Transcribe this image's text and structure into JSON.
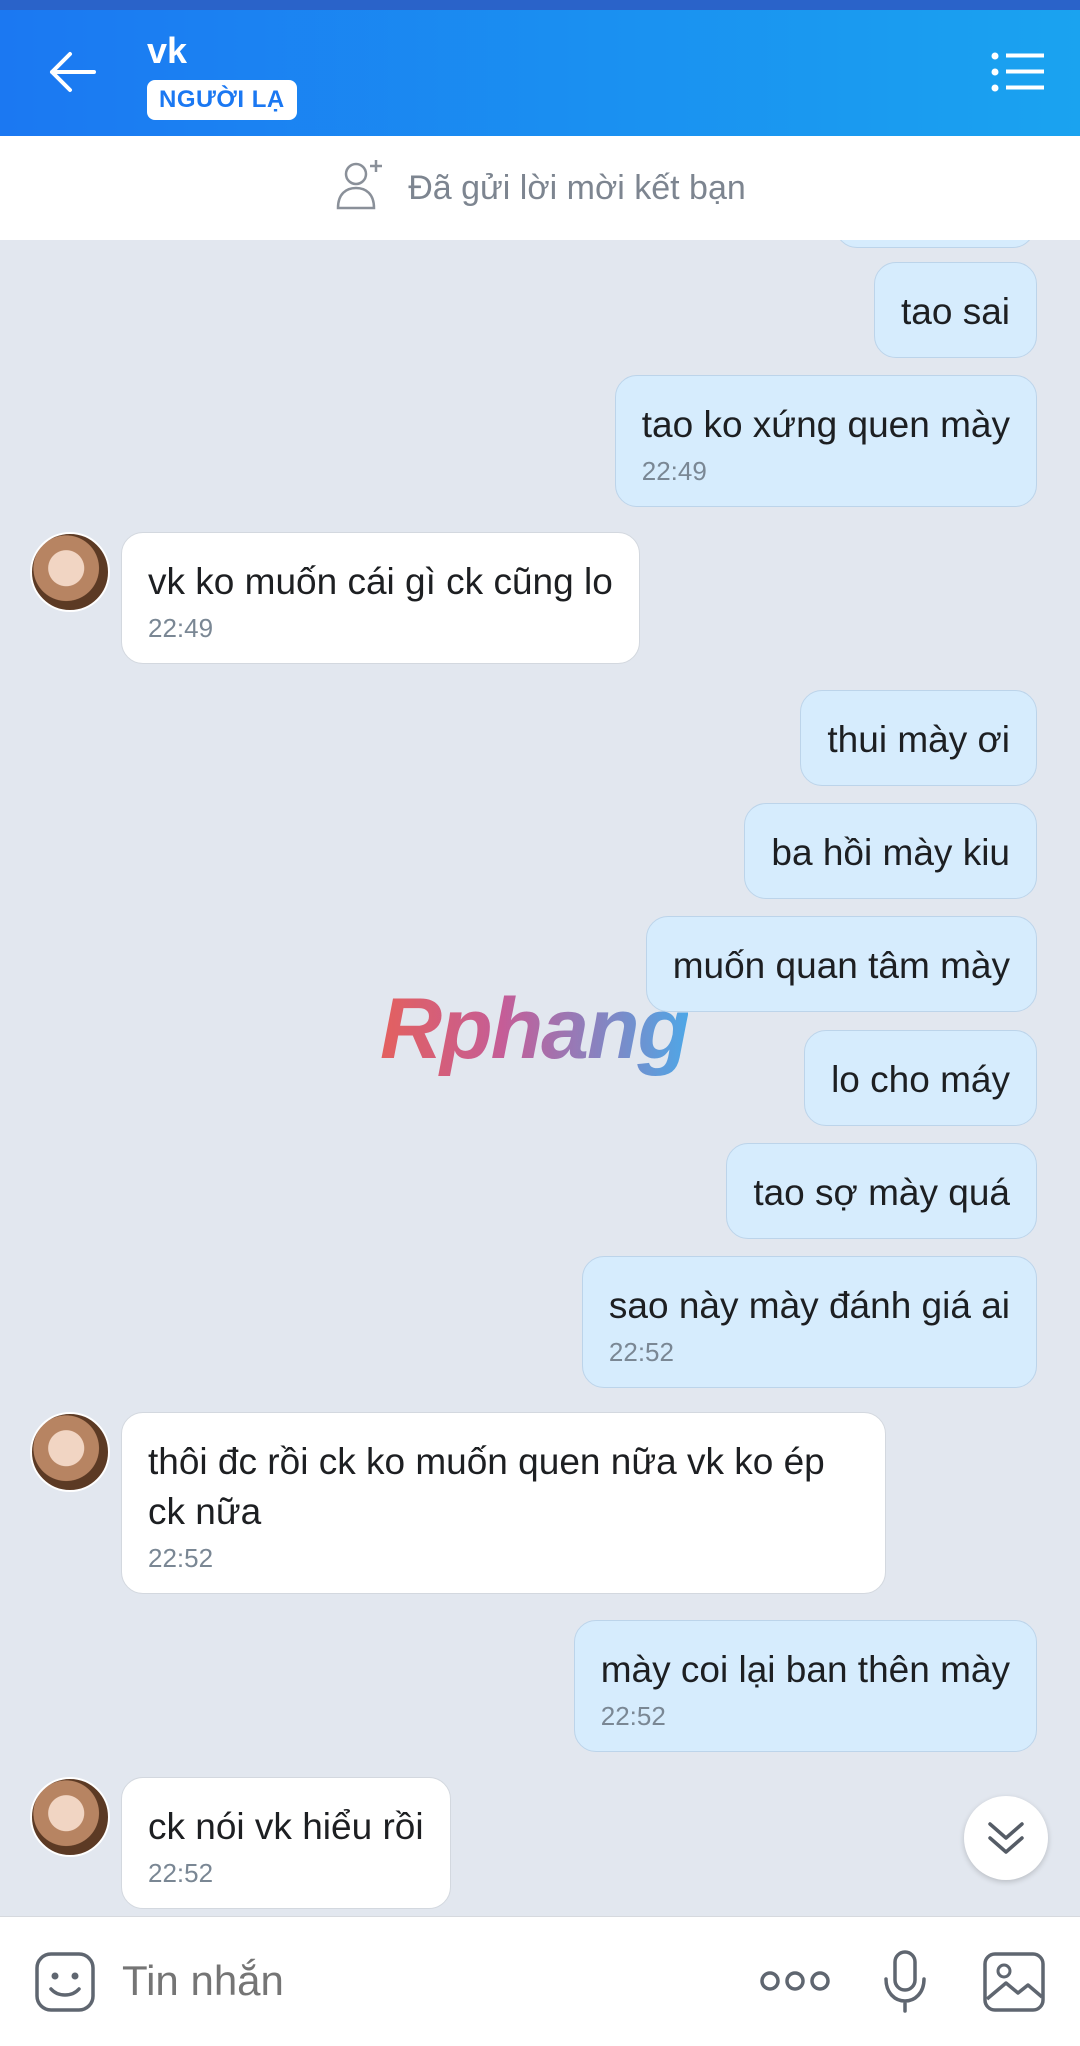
{
  "header": {
    "title": "vk",
    "badge": "NGƯỜI LẠ",
    "back_icon": "arrow-left-icon",
    "menu_icon": "list-menu-icon"
  },
  "friend_request": {
    "text": "Đã gửi lời mời kết bạn",
    "icon": "add-person-icon"
  },
  "watermark": "Rphang",
  "messages": [
    {
      "side": "out",
      "text": "tao sai",
      "time": ""
    },
    {
      "side": "out",
      "text": "tao ko xứng quen mày",
      "time": "22:49"
    },
    {
      "side": "in",
      "text": "vk ko muốn cái gì ck cũng  lo",
      "time": "22:49"
    },
    {
      "side": "out",
      "text": "thui mày ơi",
      "time": ""
    },
    {
      "side": "out",
      "text": "ba hồi mày kiu",
      "time": ""
    },
    {
      "side": "out",
      "text": "muốn quan tâm mày",
      "time": ""
    },
    {
      "side": "out",
      "text": "lo cho máy",
      "time": ""
    },
    {
      "side": "out",
      "text": "tao sợ mày quá",
      "time": ""
    },
    {
      "side": "out",
      "text": "sao này mày đánh giá ai",
      "time": "22:52"
    },
    {
      "side": "in",
      "text": "thôi  đc rồi  ck ko muốn  quen  nữa  vk ko ép  ck nữa",
      "time": "22:52"
    },
    {
      "side": "out",
      "text": "mày coi lại ban thên mày",
      "time": "22:52"
    },
    {
      "side": "in",
      "text": "ck nói  vk hiểu rồi",
      "time": "22:52"
    }
  ],
  "composer": {
    "placeholder": "Tin nhắn",
    "icons": [
      "sticker-icon",
      "more-dots-icon",
      "microphone-icon",
      "image-icon"
    ]
  },
  "scroll_down_icon": "chevron-double-down-icon",
  "colors": {
    "header_start": "#1b78f2",
    "header_end": "#1aa3f0",
    "chat_background": "#e2e7ef",
    "outgoing_bubble": "#d6ecfd",
    "incoming_bubble": "#ffffff"
  }
}
